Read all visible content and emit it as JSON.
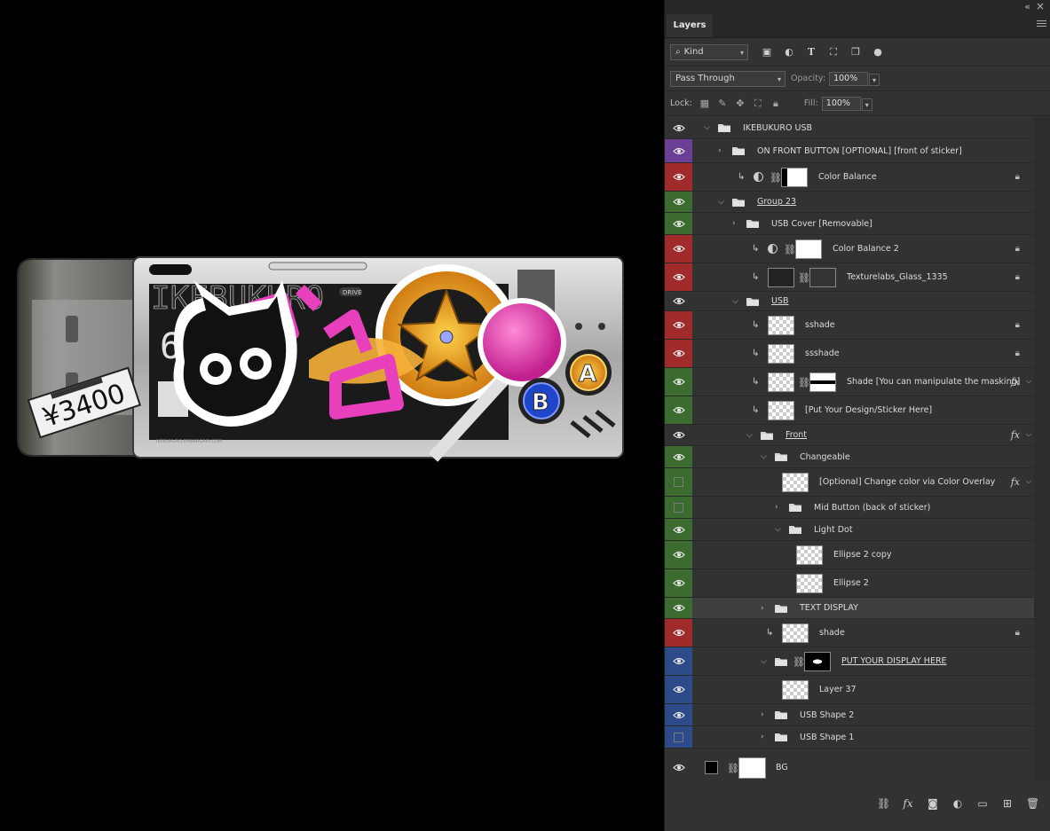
{
  "panel": {
    "tab_label": "Layers",
    "filter_kind": "Kind",
    "blend_mode": "Pass Through",
    "opacity_label": "Opacity:",
    "opacity_value": "100%",
    "lock_label": "Lock:",
    "fill_label": "Fill:",
    "fill_value": "100%"
  },
  "artwork": {
    "brand_text": "IKEBUKURO",
    "drive_tag": "DRIVE",
    "capacity_text": "64GB",
    "price_text": "¥3400",
    "button_a": "A",
    "button_b": "B",
    "small_caption": "IKEBUKURO.EMBARGAIN.COM",
    "colors": {
      "pink": "#e83fbd",
      "gold": "#e7a21f",
      "blue": "#1f45c9",
      "body": "#b9b9b9"
    }
  },
  "layers": [
    {
      "name": "IKEBUKURO USB",
      "color": "none",
      "vis": "eye"
    },
    {
      "name": "ON FRONT BUTTON [OPTIONAL] [front of sticker]",
      "color": "purple",
      "vis": "eye"
    },
    {
      "name": "Color Balance",
      "color": "red",
      "vis": "eye"
    },
    {
      "name": "Group 23",
      "color": "green",
      "vis": "eye"
    },
    {
      "name": "USB Cover [Removable]",
      "color": "green",
      "vis": "eye"
    },
    {
      "name": "Color Balance 2",
      "color": "red",
      "vis": "eye"
    },
    {
      "name": "Texturelabs_Glass_1335",
      "color": "red",
      "vis": "eye"
    },
    {
      "name": "USB",
      "color": "none",
      "vis": "eye"
    },
    {
      "name": "sshade",
      "color": "red",
      "vis": "eye"
    },
    {
      "name": "ssshade",
      "color": "red",
      "vis": "eye"
    },
    {
      "name": "Shade [You can manipulate the masking]",
      "color": "green",
      "vis": "eye"
    },
    {
      "name": "[Put Your Design/Sticker Here]",
      "color": "green",
      "vis": "eye"
    },
    {
      "name": "Front",
      "color": "none",
      "vis": "eye"
    },
    {
      "name": "Changeable",
      "color": "green",
      "vis": "eye"
    },
    {
      "name": "[Optional] Change color via Color Overlay",
      "color": "green",
      "vis": "box"
    },
    {
      "name": "Mid Button (back of sticker)",
      "color": "green",
      "vis": "box"
    },
    {
      "name": "Light Dot",
      "color": "green",
      "vis": "eye"
    },
    {
      "name": "Ellipse 2 copy",
      "color": "green",
      "vis": "eye"
    },
    {
      "name": "Ellipse 2",
      "color": "green",
      "vis": "eye"
    },
    {
      "name": "TEXT DISPLAY",
      "color": "green",
      "vis": "eye"
    },
    {
      "name": "shade",
      "color": "red",
      "vis": "eye"
    },
    {
      "name": "PUT YOUR DISPLAY HERE",
      "color": "blue",
      "vis": "eye"
    },
    {
      "name": "Layer 37",
      "color": "blue",
      "vis": "eye"
    },
    {
      "name": "USB Shape 2",
      "color": "blue",
      "vis": "eye"
    },
    {
      "name": "USB Shape 1",
      "color": "blue",
      "vis": "box"
    },
    {
      "name": "BG",
      "color": "none",
      "vis": "eye"
    }
  ]
}
